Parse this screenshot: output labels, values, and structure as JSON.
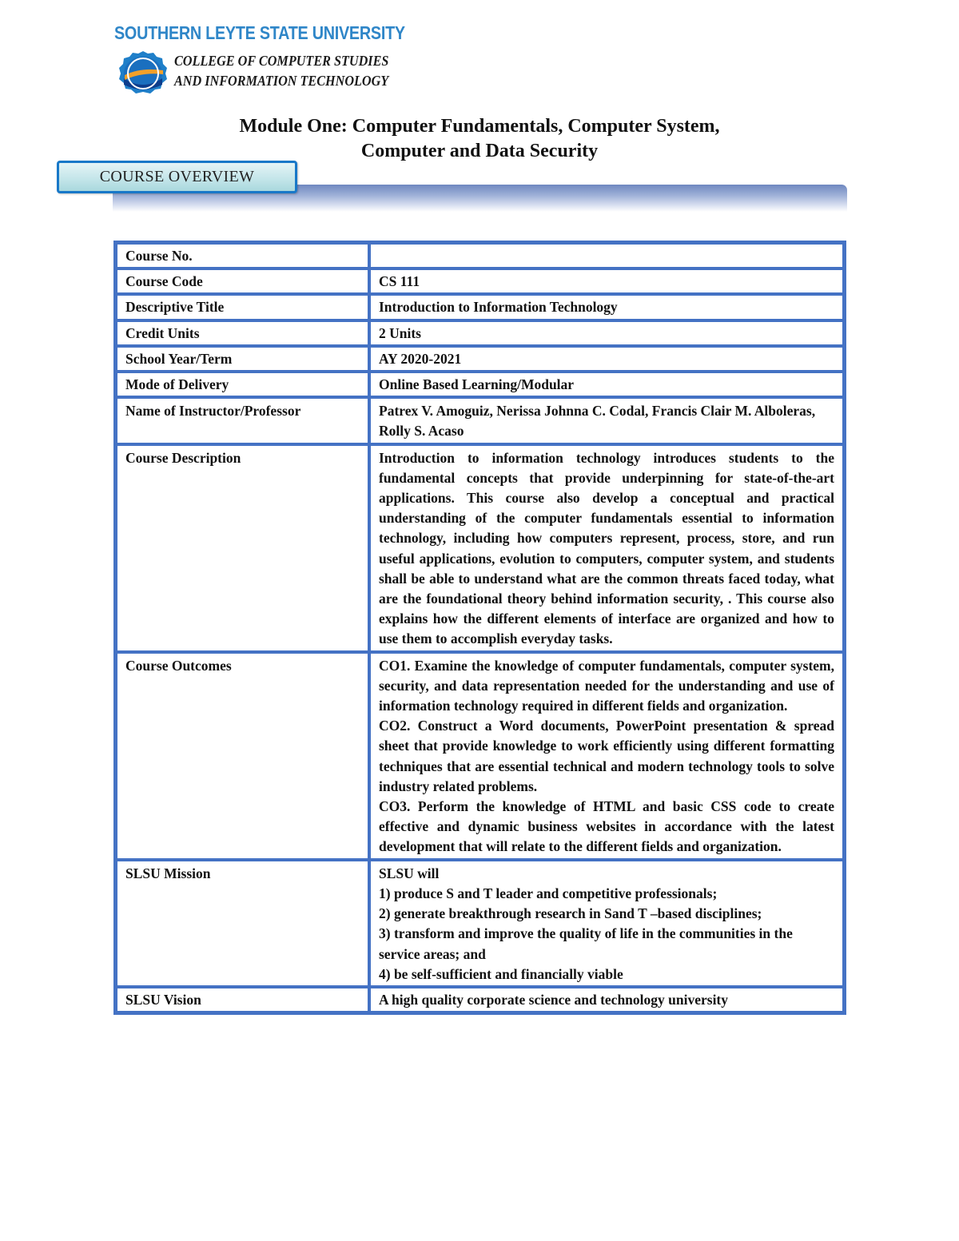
{
  "header": {
    "university_name": "SOUTHERN LEYTE STATE UNIVERSITY",
    "college_name_line1": "COLLEGE OF COMPUTER STUDIES",
    "college_name_line2": "AND INFORMATION TECHNOLOGY",
    "logo_icon": "university-seal-icon",
    "brand_color": "#2f86c8",
    "seal_colors": {
      "outer": "#1f7fc9",
      "inner": "#0d3d8c",
      "swoosh": "#f2a02a"
    }
  },
  "module": {
    "title_line1": "Module One: Computer Fundamentals, Computer System,",
    "title_line2": "Computer and Data Security"
  },
  "section_banner": {
    "label": "COURSE OVERVIEW",
    "border_color": "#1878c8",
    "bar_color": "#6f88c0"
  },
  "table": {
    "border_color": "#4472c4",
    "rows": [
      {
        "label": "Course No.",
        "value": [
          ""
        ]
      },
      {
        "label": "Course Code",
        "value": [
          "CS 111"
        ]
      },
      {
        "label": "Descriptive Title",
        "value": [
          "Introduction to Information Technology"
        ]
      },
      {
        "label": "Credit Units",
        "value": [
          "2 Units"
        ]
      },
      {
        "label": "School Year/Term",
        "value": [
          "AY 2020-2021"
        ]
      },
      {
        "label": "Mode of Delivery",
        "value": [
          "Online Based Learning/Modular"
        ]
      },
      {
        "label": "Name of Instructor/Professor",
        "value": [
          "Patrex V. Amoguiz, Nerissa Johnna C. Codal, Francis Clair M. Alboleras, Rolly S. Acaso"
        ]
      },
      {
        "label": "Course Description",
        "value": [
          "Introduction to information technology introduces students to the fundamental concepts that provide underpinning for state-of-the-art applications.  This course also develop a conceptual and practical understanding of the computer fundamentals essential to information technology, including how computers represent, process, store, and run useful applications, evolution to computers, computer system, and students shall be able to understand what are the common threats faced today, what are the foundational theory behind information security, . This course also explains how the different elements of interface are organized and how to use them to accomplish everyday tasks."
        ]
      },
      {
        "label": "Course Outcomes",
        "value": [
          "CO1. Examine the knowledge of computer fundamentals, computer system, security, and data representation needed for the understanding and use of information technology required in different fields and organization.",
          "CO2. Construct a Word documents, PowerPoint presentation & spread sheet that provide knowledge to work efficiently using different formatting techniques that are essential technical and modern technology tools to solve industry related problems.",
          "CO3. Perform the knowledge of HTML and basic CSS code to create effective and dynamic business websites in accordance with the latest development that will relate to the different fields and organization."
        ]
      },
      {
        "label": "SLSU Mission",
        "value": [
          "SLSU will",
          "1) produce S and T leader and competitive professionals;",
          "2) generate breakthrough research in Sand T –based disciplines;",
          "3) transform and improve the quality of life in the communities in the service areas; and",
          "4) be self-sufficient and financially viable"
        ]
      },
      {
        "label": "SLSU Vision",
        "value": [
          "A high quality corporate science and technology university"
        ]
      }
    ]
  }
}
